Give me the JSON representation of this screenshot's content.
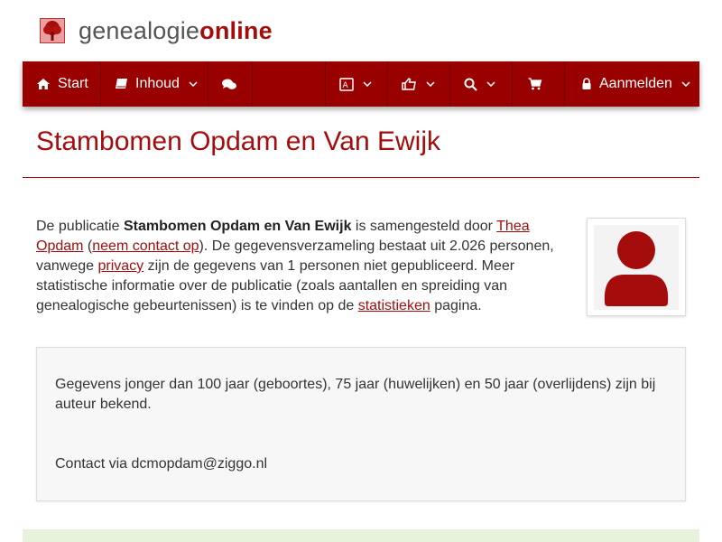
{
  "brand": {
    "text_part1": "genealogie",
    "text_part2": "online",
    "logo_icon": "tree-icon"
  },
  "nav": {
    "start_label": "Start",
    "inhoud_label": "Inhoud",
    "aanmelden_label": "Aanmelden"
  },
  "page": {
    "title": "Stambomen Opdam en Van Ewijk"
  },
  "intro": {
    "t1": "De publicatie ",
    "pub_name": "Stambomen Opdam en Van Ewijk",
    "t2": " is samengesteld door ",
    "author_link": "Thea Opdam",
    "t3": " (",
    "contact_link": "neem contact op",
    "t4": "). De gegevensverzameling bestaat uit 2.026 personen, vanwege ",
    "privacy_link": "privacy",
    "t5": " zijn de gegevens van 1 personen niet gepubliceerd. Meer statistische informatie over de publicatie (zoals aantallen en spreiding van genealogische gebeurtenissen) is te vinden op de ",
    "stats_link": "statistieken",
    "t6": " pagina."
  },
  "note": {
    "p1": "Gegevens jonger dan 100 jaar (geboortes), 75 jaar (huwelijken) en 50 jaar (overlijdens) zijn bij auteur bekend.",
    "p2": "Contact via dcmopdam@ziggo.nl"
  },
  "colors": {
    "brand_red": "#a50d0d",
    "navbar_bg": "#990000",
    "bottom_bar": "#e8f3dc"
  }
}
